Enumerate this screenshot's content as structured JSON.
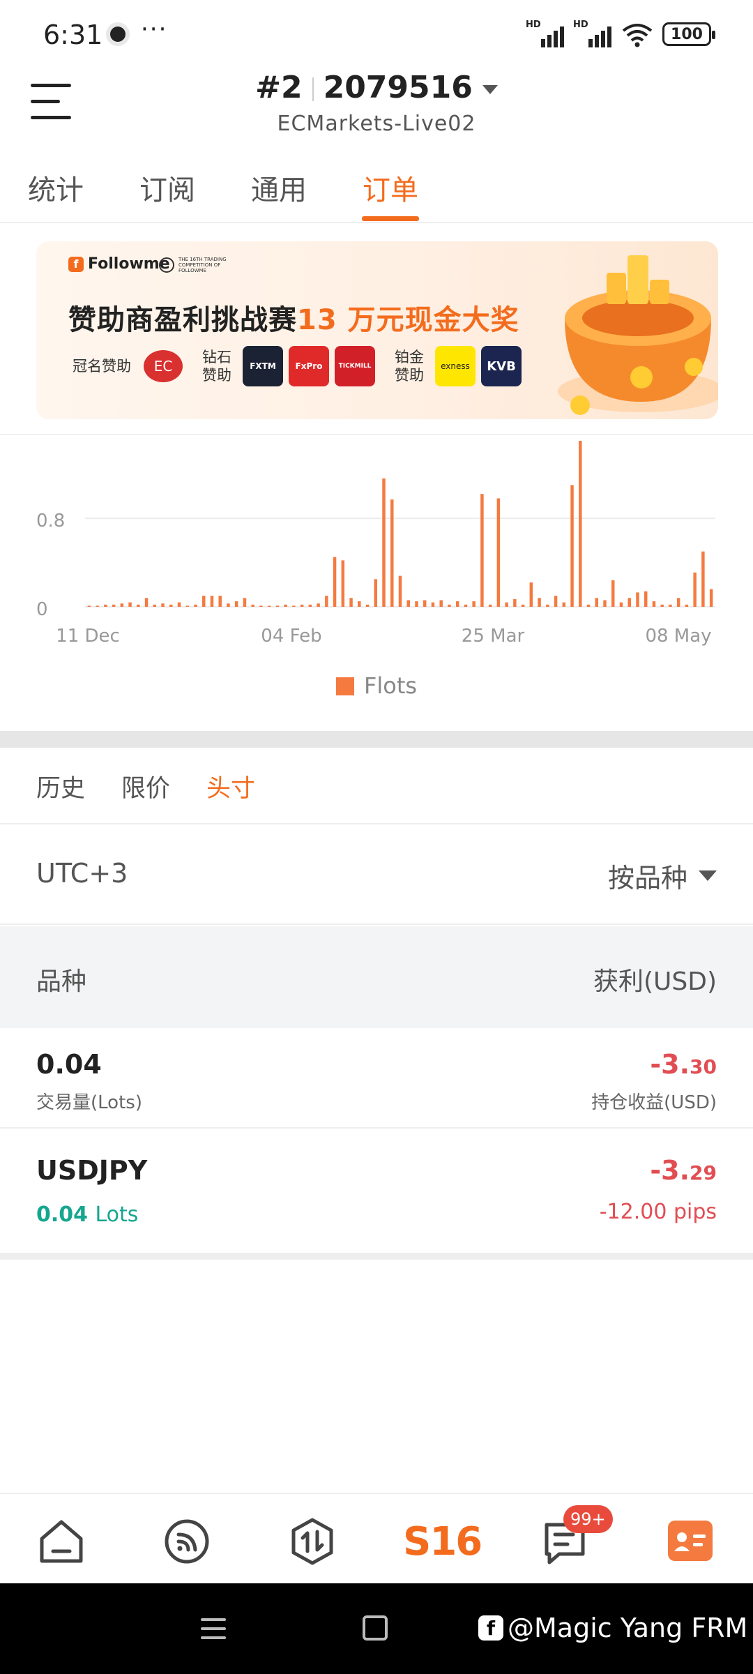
{
  "status_bar": {
    "time": "6:31",
    "more": "···",
    "hd_label": "HD",
    "battery": "100"
  },
  "header": {
    "account_number": "#2",
    "account_id": "2079516",
    "server": "ECMarkets-Live02"
  },
  "top_tabs": [
    "统计",
    "订阅",
    "通用",
    "订单"
  ],
  "top_tabs_active": "订单",
  "banner": {
    "brand": "Followme",
    "edition": "THE 16TH TRADING COMPETITION OF FOLLOWME",
    "headline_prefix": "赞助商盈利挑战赛",
    "headline_highlight": "13 万元现金大奖",
    "title_sponsor_label": "冠名赞助",
    "title_sponsor": "EC",
    "diamond_label": "钻石赞助",
    "diamond_sponsors": [
      "FXTM",
      "FxPro",
      "TICKMILL"
    ],
    "platinum_label": "铂金赞助",
    "platinum_sponsors": [
      "exness",
      "KVB"
    ]
  },
  "chart_data": {
    "type": "bar",
    "series": [
      {
        "name": "Flots",
        "color": "#f47a40"
      }
    ],
    "x_ticks": [
      "11 Dec",
      "04 Feb",
      "25 Mar",
      "08 May"
    ],
    "y_ticks": [
      "0",
      "0.8"
    ],
    "values": [
      0.01,
      0.01,
      0.02,
      0.02,
      0.03,
      0.04,
      0.02,
      0.08,
      0.02,
      0.03,
      0.02,
      0.04,
      0.01,
      0.02,
      0.1,
      0.1,
      0.1,
      0.03,
      0.05,
      0.08,
      0.02,
      0.01,
      0.01,
      0.01,
      0.02,
      0.01,
      0.02,
      0.02,
      0.03,
      0.1,
      0.45,
      0.42,
      0.08,
      0.05,
      0.02,
      0.25,
      1.16,
      0.97,
      0.28,
      0.06,
      0.05,
      0.06,
      0.04,
      0.06,
      0.02,
      0.05,
      0.02,
      0.05,
      1.02,
      0.02,
      0.98,
      0.04,
      0.07,
      0.02,
      0.22,
      0.08,
      0.02,
      0.1,
      0.04,
      1.1,
      1.5,
      0.02,
      0.08,
      0.06,
      0.24,
      0.04,
      0.08,
      0.13,
      0.14,
      0.05,
      0.02,
      0.02,
      0.08,
      0.02,
      0.31,
      0.5,
      0.16
    ],
    "ylim": [
      0,
      1.5
    ],
    "legend": "bottom-center"
  },
  "sub_tabs": [
    "历史",
    "限价",
    "头寸"
  ],
  "sub_tabs_active": "头寸",
  "filter": {
    "timezone": "UTC+3",
    "group_by": "按品种"
  },
  "table": {
    "col_symbol": "品种",
    "col_profit": "获利(USD)"
  },
  "summary": {
    "lots": "0.04",
    "lots_label": "交易量(Lots)",
    "profit_main": "-3.",
    "profit_dec": "30",
    "profit_label": "持仓收益(USD)"
  },
  "position": {
    "symbol": "USDJPY",
    "lots_value": "0.04",
    "lots_unit": "Lots",
    "profit_main": "-3.",
    "profit_dec": "29",
    "pips": "-12.00 pips"
  },
  "bottom_nav": {
    "s16_label": "S16",
    "badge": "99+"
  },
  "watermark": "@Magic Yang FRM"
}
